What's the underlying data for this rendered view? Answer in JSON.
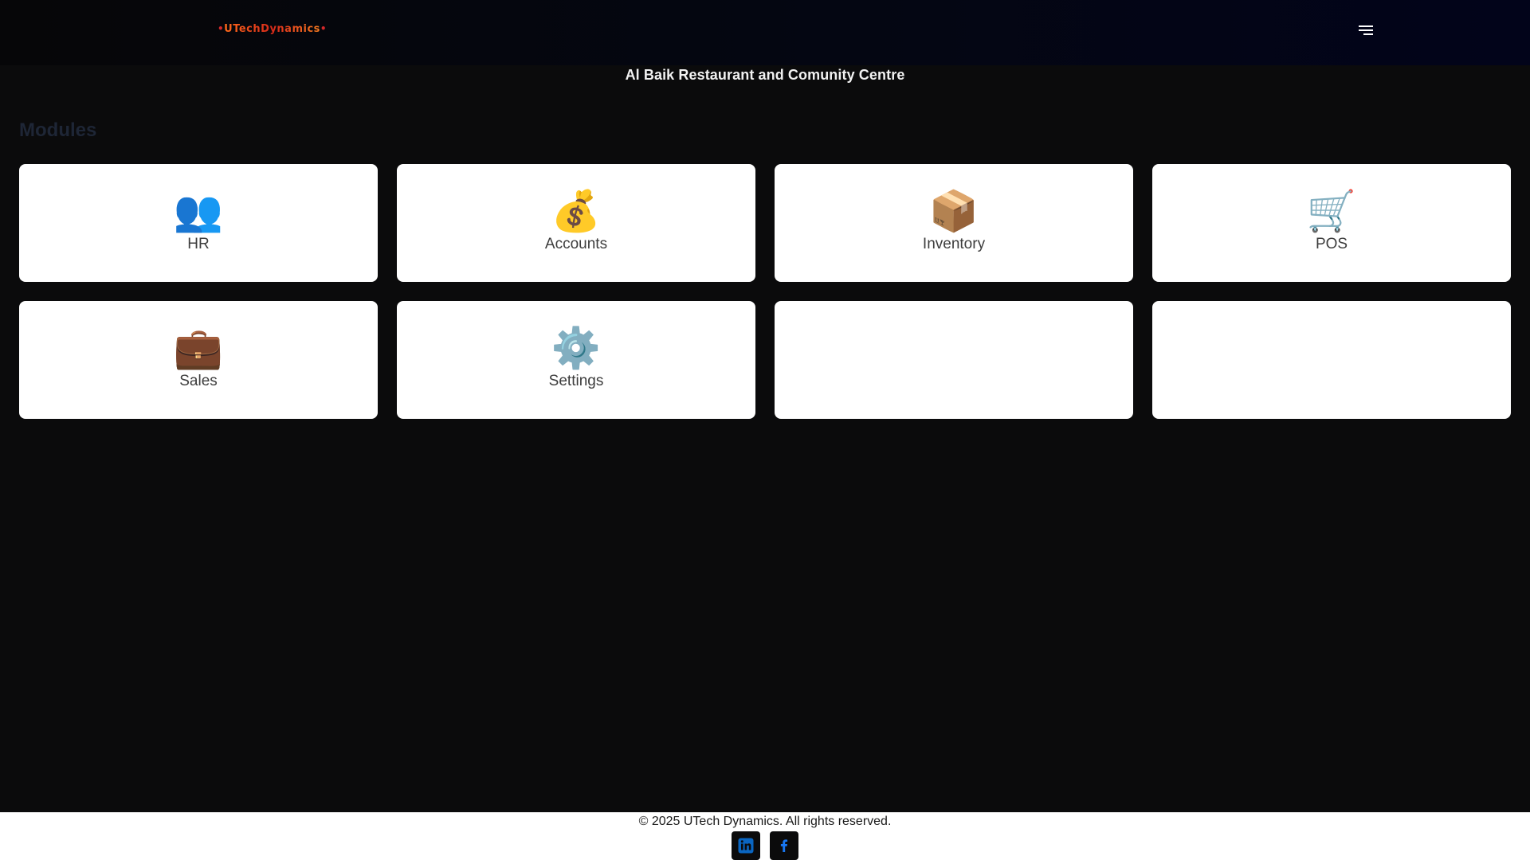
{
  "header": {
    "logo_text": "UTechDynamics",
    "logo_left_mark": "•",
    "logo_right_mark": "•",
    "menu_icon": "hamburger-icon"
  },
  "org": {
    "title": "Al Baik Restaurant and Comunity Centre"
  },
  "modules": {
    "title": "Modules",
    "items": [
      {
        "label": "HR",
        "icon": "👥",
        "icon_name": "people-icon"
      },
      {
        "label": "Accounts",
        "icon": "💰",
        "icon_name": "money-bag-icon"
      },
      {
        "label": "Inventory",
        "icon": "📦",
        "icon_name": "package-icon"
      },
      {
        "label": "POS",
        "icon": "🛒",
        "icon_name": "shopping-cart-icon"
      },
      {
        "label": "Sales",
        "icon": "💼",
        "icon_name": "briefcase-icon"
      },
      {
        "label": "Settings",
        "icon": "⚙️",
        "icon_name": "gear-icon"
      }
    ]
  },
  "footer": {
    "copyright": "© 2025 UTech Dynamics. All rights reserved.",
    "socials": [
      {
        "icon_name": "linkedin-icon",
        "color": "#0a66c2"
      },
      {
        "icon_name": "facebook-icon",
        "color": "#1877f2"
      }
    ]
  },
  "colors": {
    "page_bg": "#0b0b0c",
    "card_bg": "#ffffff",
    "section_title": "#1e2636",
    "logo_accent": "#e04a1a"
  }
}
